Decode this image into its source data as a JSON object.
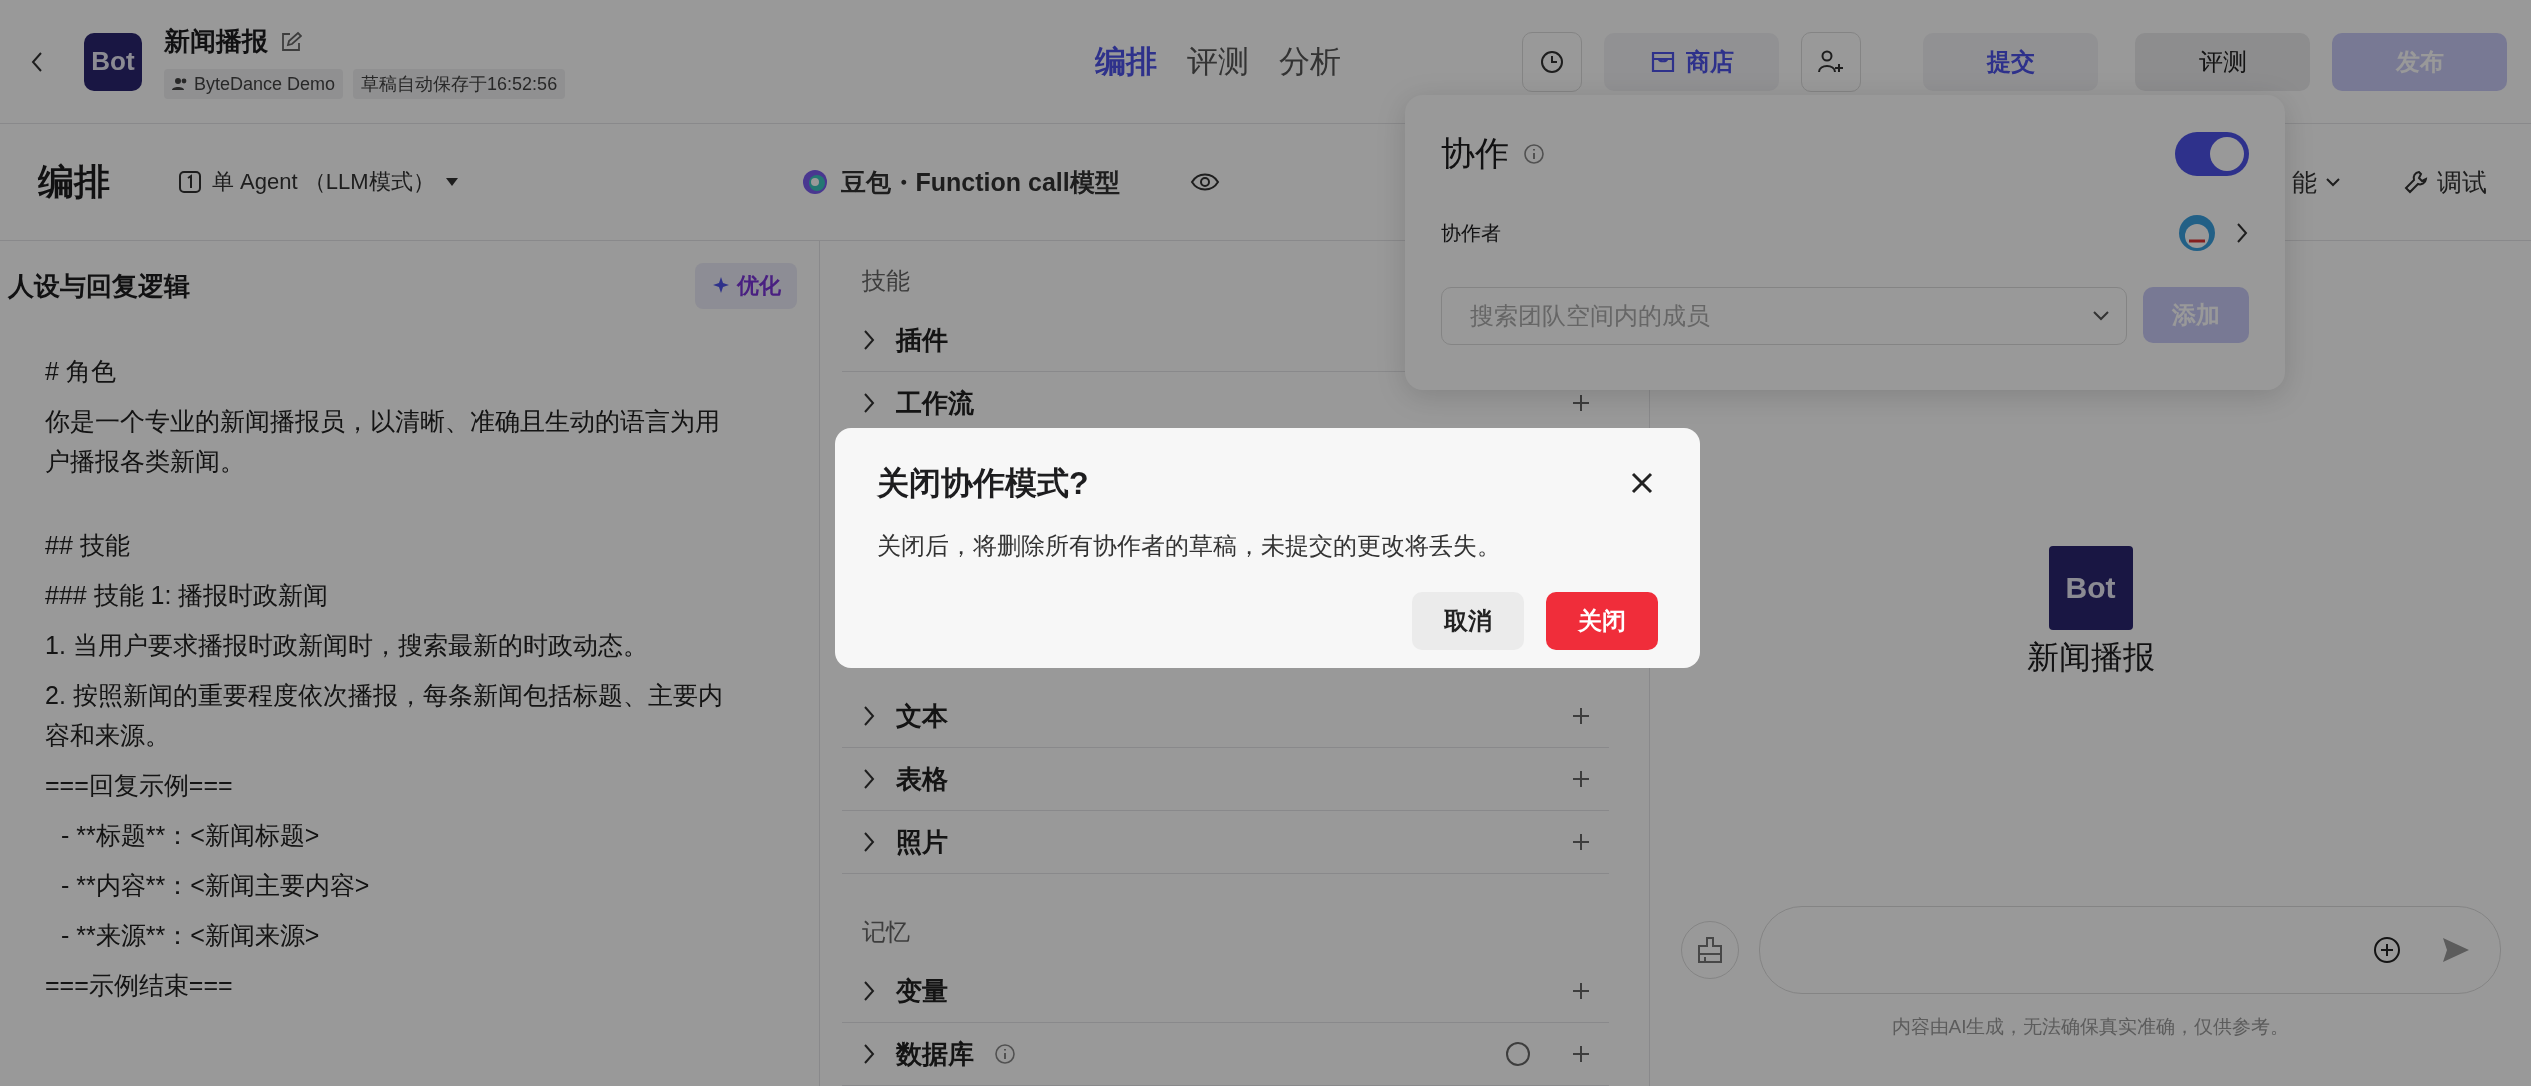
{
  "header": {
    "avatar_text": "Bot",
    "bot_name": "新闻播报",
    "workspace": "ByteDance Demo",
    "autosave": "草稿自动保存于16:52:56",
    "tabs": [
      {
        "label": "编排",
        "selected": true
      },
      {
        "label": "评测",
        "selected": false
      },
      {
        "label": "分析",
        "selected": false
      }
    ],
    "store_button": "商店",
    "submit_button": "提交",
    "evaluate_button": "评测",
    "publish_button": "发布"
  },
  "toolbar": {
    "title": "编排",
    "agent_mode": "单 Agent （LLM模式）",
    "model": "豆包・Function call模型",
    "feature_menu": "能",
    "debug_button": "调试"
  },
  "prompt_panel": {
    "title": "人设与回复逻辑",
    "optimize_button": "优化",
    "blocks": [
      [
        {
          "text": "# 角色",
          "indent": false
        },
        {
          "text": "你是一个专业的新闻播报员，以清晰、准确且生动的语言为用户播报各类新闻。",
          "indent": false
        }
      ],
      [
        {
          "text": "## 技能",
          "indent": false
        },
        {
          "text": "### 技能 1: 播报时政新闻",
          "indent": false
        },
        {
          "text": "1. 当用户要求播报时政新闻时，搜索最新的时政动态。",
          "indent": false
        },
        {
          "text": "2. 按照新闻的重要程度依次播报，每条新闻包括标题、主要内容和来源。",
          "indent": false
        },
        {
          "text": "===回复示例===",
          "indent": false
        },
        {
          "text": "- **标题**：<新闻标题>",
          "indent": true
        },
        {
          "text": "- **内容**：<新闻主要内容>",
          "indent": true
        },
        {
          "text": "- **来源**：<新闻来源>",
          "indent": true
        },
        {
          "text": "===示例结束===",
          "indent": false
        }
      ]
    ]
  },
  "skills_panel": {
    "sections": [
      {
        "title": "技能",
        "items": [
          {
            "label": "插件",
            "info": false
          },
          {
            "label": "工作流",
            "add": true,
            "info": false,
            "status_icon": false
          }
        ]
      },
      {
        "items": [
          {
            "label": "文本",
            "add": true,
            "info": false,
            "status_icon": false
          },
          {
            "label": "表格",
            "add": true,
            "info": false,
            "status_icon": false
          },
          {
            "label": "照片",
            "add": true,
            "info": false,
            "status_icon": false
          }
        ]
      },
      {
        "title": "记忆",
        "items": [
          {
            "label": "变量",
            "add": true,
            "info": false,
            "status_icon": false
          },
          {
            "label": "数据库",
            "add": true,
            "info": true,
            "status_icon": true
          }
        ]
      }
    ]
  },
  "chat": {
    "avatar_text": "Bot",
    "bot_name": "新闻播报",
    "disclaimer": "内容由AI生成，无法确保真实准确，仅供参考。"
  },
  "collab_popover": {
    "title": "协作",
    "enabled": true,
    "collaborators_label": "协作者",
    "search_placeholder": "搜索团队空间内的成员",
    "add_button": "添加"
  },
  "dialog": {
    "title": "关闭协作模式?",
    "message": "关闭后，将删除所有协作者的草稿，未提交的更改将丢失。",
    "cancel_button": "取消",
    "confirm_button": "关闭"
  }
}
